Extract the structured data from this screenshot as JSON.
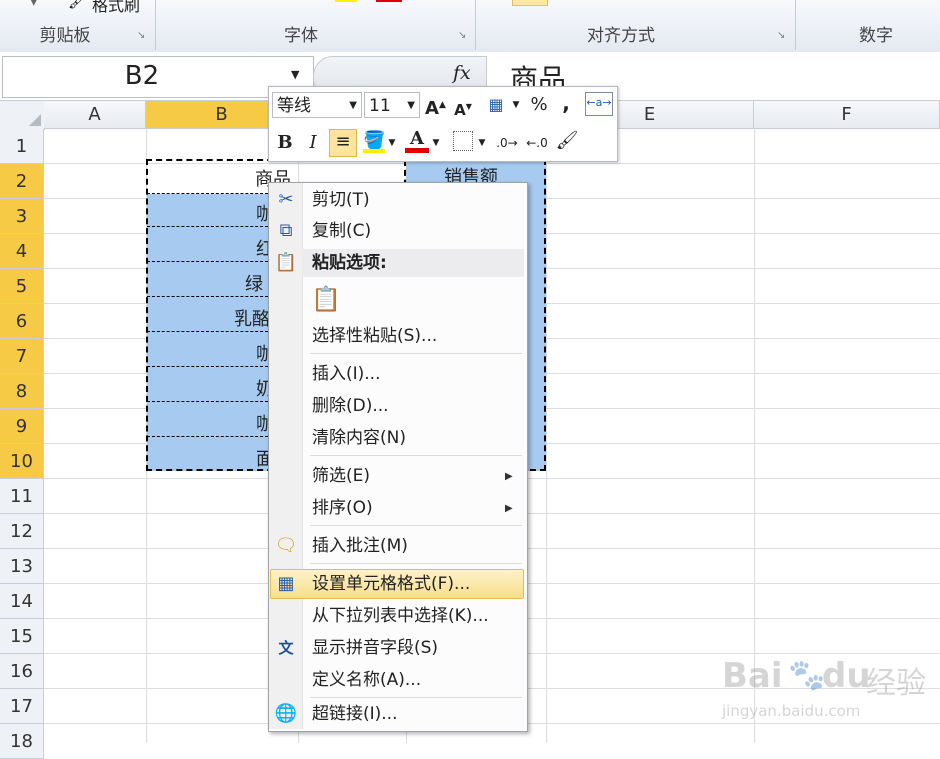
{
  "ribbon": {
    "groups": [
      "剪贴板",
      "字体",
      "对齐方式",
      "数字"
    ],
    "format_painter": "格式刷"
  },
  "namebox": {
    "value": "B2"
  },
  "formula": {
    "fx": "fx",
    "value": "商品"
  },
  "columns": [
    "A",
    "B",
    "C",
    "D",
    "E",
    "F"
  ],
  "rows": [
    "1",
    "2",
    "3",
    "4",
    "5",
    "6",
    "7",
    "8",
    "9",
    "10",
    "11",
    "12",
    "13",
    "14",
    "15",
    "16",
    "17",
    "18"
  ],
  "cells": {
    "b": [
      "商品",
      "咖",
      "红",
      "绿",
      "乳酪",
      "咖",
      "奶",
      "咖",
      "面"
    ],
    "d2": "销售额"
  },
  "mini_toolbar": {
    "font_name": "等线",
    "font_size": "11",
    "bold": "B",
    "italic": "I",
    "percent": "%",
    "comma": ",",
    "font_color_letter": "A"
  },
  "context_menu": {
    "items": [
      "剪切(T)",
      "复制(C)",
      "粘贴选项:",
      "选择性粘贴(S)...",
      "插入(I)...",
      "删除(D)...",
      "清除内容(N)",
      "筛选(E)",
      "排序(O)",
      "插入批注(M)",
      "设置单元格格式(F)...",
      "从下拉列表中选择(K)...",
      "显示拼音字段(S)",
      "定义名称(A)...",
      "超链接(I)..."
    ],
    "highlighted": "设置单元格格式(F)..."
  },
  "watermark": {
    "brand": "Bai",
    "brand2": "du",
    "brand3": "经验",
    "url": "jingyan.baidu.com"
  },
  "colors": {
    "selection": "#a6caf0",
    "header_selected": "#f7ca45",
    "menu_highlight": "#f8de8c",
    "font_color_bar": "#e00000"
  }
}
